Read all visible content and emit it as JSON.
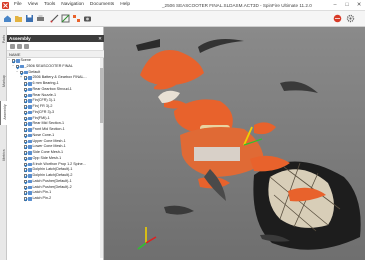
{
  "titlebar": {
    "menu": [
      "File",
      "View",
      "Tools",
      "Navigation",
      "Documents",
      "Help"
    ],
    "title": "_2506 SEASCOOTER FINAL.SLDASM.ACT3D - SpinFire Ultimate 11.2.0",
    "buttons": [
      "–",
      "□",
      "✕"
    ]
  },
  "left_tabs": [
    "Parts",
    "Markup",
    "Assembly",
    "Metrics"
  ],
  "panel": {
    "title": "Assembly",
    "close": "✕",
    "column": "NAME"
  },
  "tree": [
    {
      "label": "Scene",
      "depth": 0,
      "exp": "−"
    },
    {
      "label": "_2506 SEASCOOTER FINAL",
      "depth": 1,
      "exp": "−"
    },
    {
      "label": "Default",
      "depth": 2,
      "exp": "−"
    },
    {
      "label": "2506 Battery & Gearbox FINAL...",
      "depth": 3,
      "exp": "+"
    },
    {
      "label": "6 mm Bearing-1",
      "depth": 3
    },
    {
      "label": "Rear Gearbox Shroud-1",
      "depth": 3
    },
    {
      "label": "Rear Nozzle-1",
      "depth": 3
    },
    {
      "label": "Fin(CFR) 3)-1",
      "depth": 3
    },
    {
      "label": "Fin( FR 3)-2",
      "depth": 3
    },
    {
      "label": "Fin(CFR 3)-3",
      "depth": 3
    },
    {
      "label": "Fin(FMI)-1",
      "depth": 3
    },
    {
      "label": "Rear Mid Section-1",
      "depth": 3
    },
    {
      "label": "Front Mid Section-1",
      "depth": 3
    },
    {
      "label": "Nose Cone-1",
      "depth": 3
    },
    {
      "label": "Upper Cone Mesh-1",
      "depth": 3
    },
    {
      "label": "Lower Cone Mesh-1",
      "depth": 3
    },
    {
      "label": "Side Cone Mesh-1",
      "depth": 3
    },
    {
      "label": "Opp Side Mesh-1",
      "depth": 3
    },
    {
      "label": "8 inch Worthon Prop 1.2 Spine...",
      "depth": 3
    },
    {
      "label": "Dolphin Latch(Default)-1",
      "depth": 3
    },
    {
      "label": "Dolphin Latch(Default)-2",
      "depth": 3
    },
    {
      "label": "Latch Pusher(Default)-1",
      "depth": 3
    },
    {
      "label": "Latch Pusher(Default)-2",
      "depth": 3
    },
    {
      "label": "Latch Pin-1",
      "depth": 3
    },
    {
      "label": "Latch Pin-2",
      "depth": 3
    }
  ],
  "colors": {
    "body_orange": "#e8622c",
    "accent_yellow": "#f0d000",
    "axis_red": "#e02020",
    "axis_green": "#30c030"
  }
}
